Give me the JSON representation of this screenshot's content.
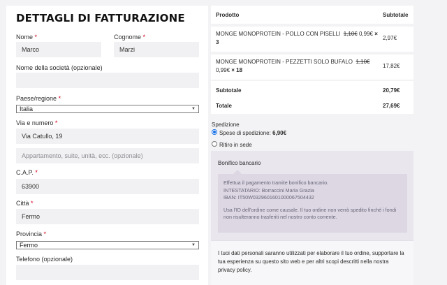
{
  "billing": {
    "heading": "DETTAGLI DI FATTURAZIONE",
    "first_name": {
      "label": "Nome",
      "value": "Marco"
    },
    "last_name": {
      "label": "Cognome",
      "value": "Marzi"
    },
    "company": {
      "label": "Nome della società (opzionale)",
      "value": ""
    },
    "country": {
      "label": "Paese/regione",
      "value": "Italia"
    },
    "street": {
      "label": "Via e numero",
      "value": "Via Catullo, 19",
      "placeholder2": "Appartamento, suite, unità, ecc. (opzionale)"
    },
    "zip": {
      "label": "C.A.P.",
      "value": "63900"
    },
    "city": {
      "label": "Città",
      "value": "Fermo"
    },
    "province": {
      "label": "Provincia",
      "value": "Fermo"
    },
    "phone": {
      "label": "Telefono (opzionale)",
      "value": ""
    },
    "required_mark": "*"
  },
  "order": {
    "col_product": "Prodotto",
    "col_subtotal": "Subtotale",
    "items": [
      {
        "name": "MONGE MONOPROTEIN - POLLO CON PISELLI",
        "old_price": "1,10€",
        "price": "0,99€",
        "qty": "× 3",
        "subtotal": "2,97€"
      },
      {
        "name": "MONGE MONOPROTEIN - PEZZETTI SOLO BUFALO",
        "old_price": "1,10€",
        "price": "0,99€",
        "qty": "× 18",
        "subtotal": "17,82€"
      }
    ],
    "subtotal_label": "Subtotale",
    "subtotal_value": "20,79€",
    "total_label": "Totale",
    "total_value": "27,69€"
  },
  "shipping": {
    "title": "Spedizione",
    "option1_label": "Spese di spedizione:",
    "option1_value": "6,90€",
    "option2_label": "Ritiro in sede"
  },
  "payment": {
    "method": "Bonifico bancario",
    "line1": "Effettua il pagamento tramite bonifico bancario.",
    "line2": "INTESTATARIO: Borraccini Maria Grazia",
    "line3": "IBAN: IT50W0329601601000067504432",
    "line4": "Usa l'ID dell'ordine come causale. Il tuo ordine non verrà spedito finché i fondi non risulteranno trasferiti nel nostro conto corrente."
  },
  "privacy": {
    "text": "I tuoi dati personali saranno utilizzati per elaborare il tuo ordine, supportare la tua esperienza su questo sito web e per altri scopi descritti nella nostra privacy policy."
  }
}
